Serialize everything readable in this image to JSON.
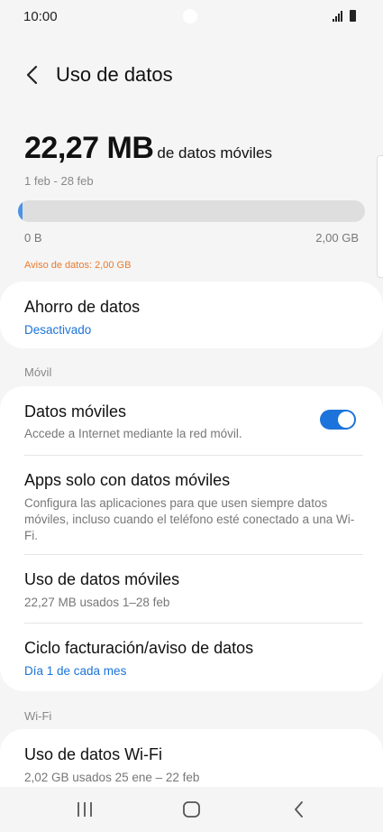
{
  "status_bar": {
    "time": "10:00"
  },
  "header": {
    "title": "Uso de datos"
  },
  "summary": {
    "amount": "22,27 MB",
    "unit_label": "de datos móviles",
    "period": "1 feb - 28 feb",
    "usage_fraction": 0.011,
    "axis_min": "0 B",
    "axis_max": "2,00 GB",
    "warning": "Aviso de datos: 2,00 GB"
  },
  "data_saver": {
    "title": "Ahorro de datos",
    "status": "Desactivado"
  },
  "sections": {
    "mobile": "Móvil",
    "wifi": "Wi-Fi"
  },
  "mobile_items": {
    "mobile_data": {
      "title": "Datos móviles",
      "subtitle": "Accede a Internet mediante la red móvil.",
      "enabled": true
    },
    "mobile_only_apps": {
      "title": "Apps solo con datos móviles",
      "subtitle": "Configura las aplicaciones para que usen siempre datos móviles, incluso cuando el teléfono esté conectado a una Wi-Fi."
    },
    "mobile_usage": {
      "title": "Uso de datos móviles",
      "subtitle": "22,27 MB usados 1–28 feb"
    },
    "billing": {
      "title": "Ciclo facturación/aviso de datos",
      "subtitle": "Día 1 de cada mes"
    }
  },
  "wifi_items": {
    "wifi_usage": {
      "title": "Uso de datos Wi-Fi",
      "subtitle": "2,02 GB usados 25 ene – 22 feb"
    }
  },
  "colors": {
    "accent": "#1b73db",
    "warning": "#e87a2f",
    "background": "#f5f5f5"
  }
}
